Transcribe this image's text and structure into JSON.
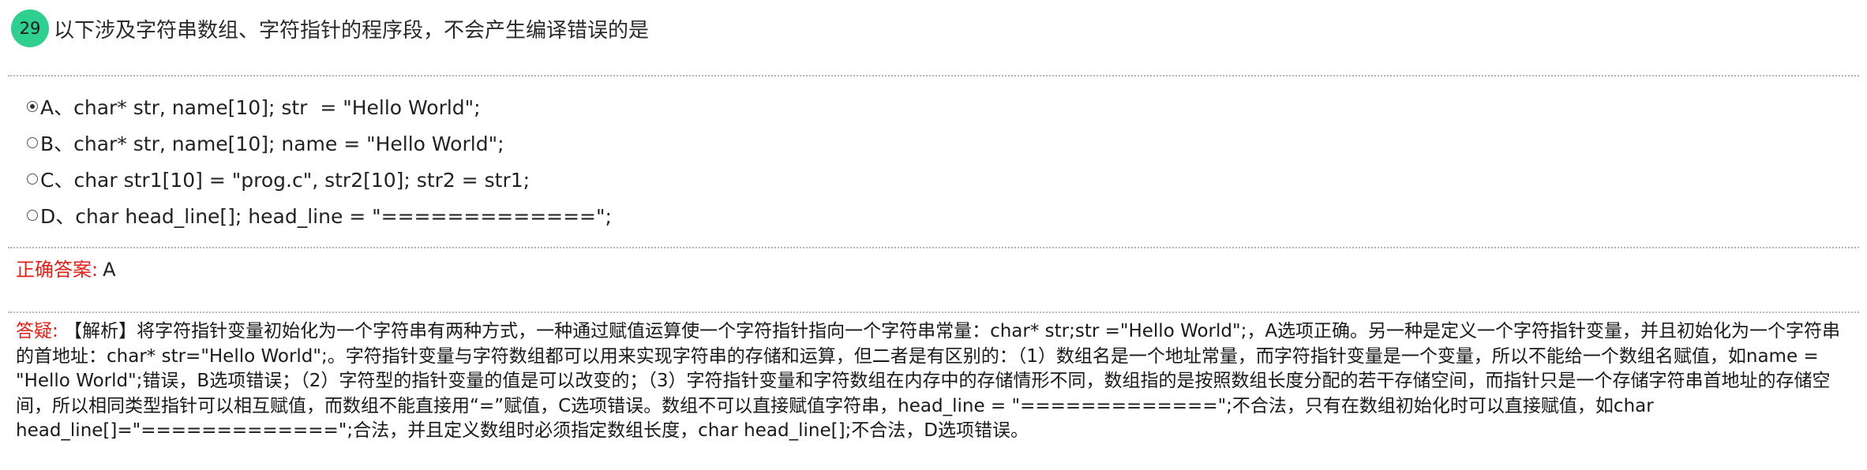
{
  "question": {
    "number": "29",
    "title": "以下涉及字符串数组、字符指针的程序段，不会产生编译错误的是"
  },
  "options": [
    {
      "text": "A、char* str, name[10]; str  = \"Hello World\";",
      "checked": true
    },
    {
      "text": "B、char* str, name[10]; name = \"Hello World\";",
      "checked": false
    },
    {
      "text": "C、char str1[10] = \"prog.c\", str2[10]; str2 = str1;",
      "checked": false
    },
    {
      "text": "D、char head_line[]; head_line = \"=============\";",
      "checked": false
    }
  ],
  "answer": {
    "label": "正确答案:",
    "value": "A"
  },
  "analysis": {
    "label": "答疑:",
    "text": "【解析】将字符指针变量初始化为一个字符串有两种方式，一种通过赋值运算使一个字符指针指向一个字符串常量：char* str;str  =\"Hello World\";，A选项正确。另一种是定义一个字符指针变量，并且初始化为一个字符串的首地址：char* str=\"Hello World\";。字符指针变量与字符数组都可以用来实现字符串的存储和运算，但二者是有区别的：（1）数组名是一个地址常量，而字符指针变量是一个变量，所以不能给一个数组名赋值，如name = \"Hello World\";错误，B选项错误；（2）字符型的指针变量的值是可以改变的；（3）字符指针变量和字符数组在内存中的存储情形不同，数组指的是按照数组长度分配的若干存储空间，而指针只是一个存储字符串首地址的存储空间，所以相同类型指针可以相互赋值，而数组不能直接用“=”赋值，C选项错误。数组不可以直接赋值字符串，head_line = \"=============\";不合法，只有在数组初始化时可以直接赋值，如char head_line[]=\"=============\";合法，并且定义数组时必须指定数组长度，char head_line[];不合法，D选项错误。"
  },
  "colors": {
    "badge": "#2fd08f",
    "label_red": "#e0201a",
    "divider": "#b5b5b5"
  }
}
